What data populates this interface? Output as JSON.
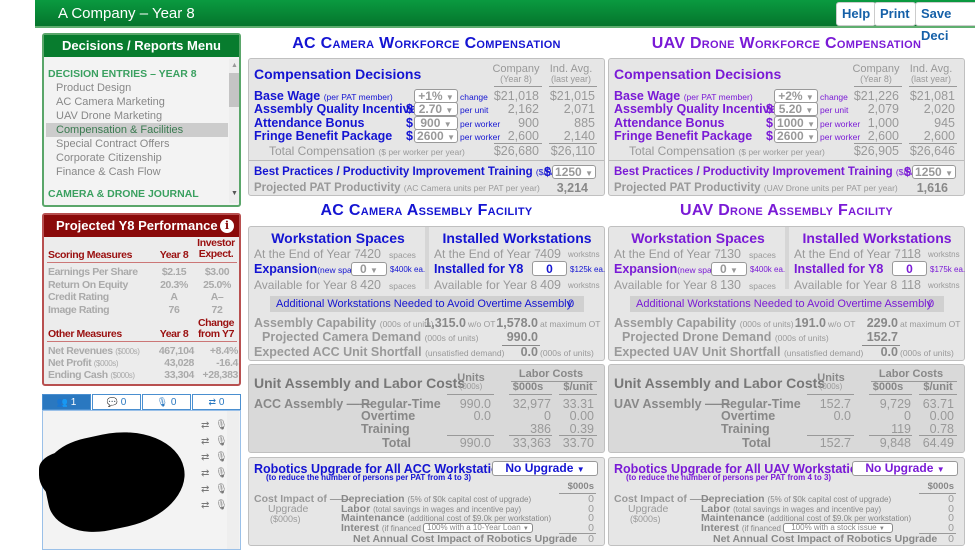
{
  "header": {
    "title": "A Company – Year 8",
    "buttons": [
      "Help",
      "Print",
      "Save Deci"
    ]
  },
  "menu": {
    "title": "Decisions / Reports Menu",
    "section": "DECISION ENTRIES – YEAR 8",
    "items": [
      "Product Design",
      "AC Camera Marketing",
      "UAV Drone Marketing",
      "Compensation & Facilities",
      "Special Contract Offers",
      "Corporate Citizenship",
      "Finance & Cash Flow"
    ],
    "selected": "Compensation & Facilities",
    "journal": "CAMERA & DRONE JOURNAL"
  },
  "performance": {
    "title": "Projected Y8 Performance",
    "info_icon": "info-circle-icon",
    "scoring_header": "Scoring Measures",
    "col_year": "Year 8",
    "col_investor": "Investor Expect.",
    "scoring": [
      {
        "label": "Earnings Per Share",
        "year8": "$2.15",
        "investor": "$3.00"
      },
      {
        "label": "Return On Equity",
        "year8": "20.3%",
        "investor": "25.0%"
      },
      {
        "label": "Credit Rating",
        "year8": "A",
        "investor": "A–"
      },
      {
        "label": "Image Rating",
        "year8": "76",
        "investor": "72"
      }
    ],
    "other_header": "Other Measures",
    "col_year2": "Year 8",
    "col_change": "Change from Y7",
    "other": [
      {
        "label": "Net Revenues",
        "sub": "($000s)",
        "year8": "467,104",
        "change": "+8.4%"
      },
      {
        "label": "Net Profit",
        "sub": "($000s)",
        "year8": "43,028",
        "change": "-16.4"
      },
      {
        "label": "Ending Cash",
        "sub": "($000s)",
        "year8": "33,304",
        "change": "+28,383"
      }
    ]
  },
  "chat": {
    "tabs": [
      {
        "icon": "users-icon",
        "count": "1"
      },
      {
        "icon": "comments-icon",
        "count": "0"
      },
      {
        "icon": "microphone-icon",
        "count": "0"
      },
      {
        "icon": "retweet-icon",
        "count": "0"
      }
    ]
  },
  "products": [
    {
      "accent": "#1414d2",
      "comp_title": "AC Camera Workforce Compensation",
      "comp": {
        "heading": "Compensation Decisions",
        "col_company": "Company",
        "col_company_sub": "(Year 8)",
        "col_ind": "Ind. Avg.",
        "col_ind_sub": "(last year)",
        "rows": [
          {
            "label": "Base Wage",
            "sub": "(per PAT member)",
            "prefix": "",
            "value": "+1%",
            "unit": "change",
            "company": "$21,018",
            "ind": "$21,015"
          },
          {
            "label": "Assembly Quality Incentive",
            "sub": "",
            "prefix": "$",
            "value": "2.70",
            "unit": "per unit",
            "company": "2,162",
            "ind": "2,071"
          },
          {
            "label": "Attendance Bonus",
            "sub": "",
            "prefix": "$",
            "value": "900",
            "unit": "per worker",
            "company": "900",
            "ind": "885"
          },
          {
            "label": "Fringe Benefit Package",
            "sub": "",
            "prefix": "$",
            "value": "2600",
            "unit": "per worker",
            "company": "2,600",
            "ind": "2,140"
          }
        ],
        "total": {
          "label": "Total Compensation",
          "sub": "($ per worker per year)",
          "company": "$26,680",
          "ind": "$26,110"
        },
        "training": {
          "label": "Best Practices / Productivity Improvement Training",
          "sub": "($/PAT)",
          "prefix": "$",
          "value": "1250"
        },
        "productivity": {
          "label": "Projected PAT Productivity",
          "sub": "(AC Camera units per PAT per year)",
          "value": "3,214"
        }
      },
      "facility_title": "AC Camera Assembly Facility",
      "facility": {
        "spaces_heading": "Workstation Spaces",
        "installed_heading": "Installed Workstations",
        "end_label": "At the End of Year 7",
        "spaces_end": "420",
        "spaces_unit": "spaces",
        "expansion_label": "Expansion",
        "expansion_sub": "(new spaces)",
        "expansion_value": "0",
        "expansion_unit": "$400k ea.",
        "avail_label": "Available for Year 8",
        "spaces_avail": "420",
        "ws_end": "409",
        "ws_unit": "workstns",
        "installed_label": "Installed for Y8",
        "installed_value": "0",
        "installed_unit": "$125k ea.",
        "ws_avail": "409",
        "additional_label": "Additional Workstations Needed to Avoid Overtime Assembly",
        "additional_value": "0",
        "capability_label": "Assembly Capability",
        "capability_sub": "(000s of units)",
        "cap_wo": "1,315.0",
        "cap_wo_unit": "w/o OT",
        "cap_max": "1,578.0",
        "cap_max_unit": "at maximum OT",
        "demand_label": "Projected Camera Demand",
        "demand_sub": "(000s of units)",
        "demand_value": "990.0",
        "shortfall_label": "Expected ACC Unit Shortfall",
        "shortfall_sub": "(unsatisfied demand)",
        "shortfall_value": "0.0",
        "shortfall_unit": "(000s of units)"
      },
      "labor": {
        "heading": "Unit Assembly and Labor Costs",
        "units_header": "Units",
        "units_sub": "(000s)",
        "labor_header": "Labor Costs",
        "col_cost": "$000s",
        "col_unit": "$/unit",
        "group_label": "ACC Assembly ——",
        "rows": [
          {
            "label": "Regular-Time",
            "units": "990.0",
            "cost": "32,977",
            "per_unit": "33.31"
          },
          {
            "label": "Overtime",
            "units": "0.0",
            "cost": "0",
            "per_unit": "0.00"
          },
          {
            "label": "Training",
            "units": "",
            "cost": "386",
            "per_unit": "0.39"
          },
          {
            "label": "Total",
            "units": "990.0",
            "cost": "33,363",
            "per_unit": "33.70"
          }
        ]
      },
      "robotics": {
        "heading": "Robotics Upgrade for All ACC Workstations",
        "sub": "(to reduce the number of persons per PAT from 4 to 3)",
        "select": "No Upgrade",
        "col": "$000s",
        "impact1": "Cost Impact of ——",
        "impact2": "Upgrade",
        "impact3": "($000s)",
        "rows": [
          {
            "label": "Depreciation",
            "sub": "(5% of $0k capital cost of upgrade)",
            "value": "0"
          },
          {
            "label": "Labor",
            "sub": "(total savings in wages and incentive pay)",
            "value": "0"
          },
          {
            "label": "Maintenance",
            "sub": "(additional cost of $9.0k per workstation)",
            "value": "0"
          },
          {
            "label": "Interest",
            "sub": "(if financed",
            "value": "0"
          }
        ],
        "financing": "100% with a 10-Year Loan",
        "net_label": "Net Annual Cost Impact of Robotics Upgrade",
        "net_value": "0"
      }
    },
    {
      "accent": "#7a1ad6",
      "comp_title": "UAV Drone Workforce Compensation",
      "comp": {
        "heading": "Compensation Decisions",
        "col_company": "Company",
        "col_company_sub": "(Year 8)",
        "col_ind": "Ind. Avg.",
        "col_ind_sub": "(last year)",
        "rows": [
          {
            "label": "Base Wage",
            "sub": "(per PAT member)",
            "prefix": "",
            "value": "+2%",
            "unit": "change",
            "company": "$21,226",
            "ind": "$21,081"
          },
          {
            "label": "Assembly Quality Incentive",
            "sub": "",
            "prefix": "$",
            "value": "5.20",
            "unit": "per unit",
            "company": "2,079",
            "ind": "2,020"
          },
          {
            "label": "Attendance Bonus",
            "sub": "",
            "prefix": "$",
            "value": "1000",
            "unit": "per worker",
            "company": "1,000",
            "ind": "945"
          },
          {
            "label": "Fringe Benefit Package",
            "sub": "",
            "prefix": "$",
            "value": "2600",
            "unit": "per worker",
            "company": "2,600",
            "ind": "2,600"
          }
        ],
        "total": {
          "label": "Total Compensation",
          "sub": "($ per worker per year)",
          "company": "$26,905",
          "ind": "$26,646"
        },
        "training": {
          "label": "Best Practices / Productivity Improvement Training",
          "sub": "($/PAT)",
          "prefix": "$",
          "value": "1250"
        },
        "productivity": {
          "label": "Projected PAT Productivity",
          "sub": "(UAV Drone units per PAT per year)",
          "value": "1,616"
        }
      },
      "facility_title": "UAV Drone Assembly Facility",
      "facility": {
        "spaces_heading": "Workstation Spaces",
        "installed_heading": "Installed Workstations",
        "end_label": "At the End of Year 7",
        "spaces_end": "130",
        "spaces_unit": "spaces",
        "expansion_label": "Expansion",
        "expansion_sub": "(new spaces)",
        "expansion_value": "0",
        "expansion_unit": "$400k ea.",
        "avail_label": "Available for Year 8",
        "spaces_avail": "130",
        "ws_end": "118",
        "ws_unit": "workstns",
        "installed_label": "Installed for Y8",
        "installed_value": "0",
        "installed_unit": "$175k ea.",
        "ws_avail": "118",
        "additional_label": "Additional Workstations Needed to Avoid Overtime Assembly",
        "additional_value": "0",
        "capability_label": "Assembly Capability",
        "capability_sub": "(000s of units)",
        "cap_wo": "191.0",
        "cap_wo_unit": "w/o OT",
        "cap_max": "229.0",
        "cap_max_unit": "at maximum OT",
        "demand_label": "Projected Drone Demand",
        "demand_sub": "(000s of units)",
        "demand_value": "152.7",
        "shortfall_label": "Expected UAV Unit Shortfall",
        "shortfall_sub": "(unsatisfied demand)",
        "shortfall_value": "0.0",
        "shortfall_unit": "(000s of units)"
      },
      "labor": {
        "heading": "Unit Assembly and Labor Costs",
        "units_header": "Units",
        "units_sub": "(000s)",
        "labor_header": "Labor Costs",
        "col_cost": "$000s",
        "col_unit": "$/unit",
        "group_label": "UAV Assembly ——",
        "rows": [
          {
            "label": "Regular-Time",
            "units": "152.7",
            "cost": "9,729",
            "per_unit": "63.71"
          },
          {
            "label": "Overtime",
            "units": "0.0",
            "cost": "0",
            "per_unit": "0.00"
          },
          {
            "label": "Training",
            "units": "",
            "cost": "119",
            "per_unit": "0.78"
          },
          {
            "label": "Total",
            "units": "152.7",
            "cost": "9,848",
            "per_unit": "64.49"
          }
        ]
      },
      "robotics": {
        "heading": "Robotics Upgrade for All UAV Workstations",
        "sub": "(to reduce the number of persons per PAT from 4 to 3)",
        "select": "No Upgrade",
        "col": "$000s",
        "impact1": "Cost Impact of ——",
        "impact2": "Upgrade",
        "impact3": "($000s)",
        "rows": [
          {
            "label": "Depreciation",
            "sub": "(5% of $0k capital cost of upgrade)",
            "value": "0"
          },
          {
            "label": "Labor",
            "sub": "(total savings in wages and incentive pay)",
            "value": "0"
          },
          {
            "label": "Maintenance",
            "sub": "(additional cost of $9.0k per workstation)",
            "value": "0"
          },
          {
            "label": "Interest",
            "sub": "(if financed",
            "value": "0"
          }
        ],
        "financing": "100% with a stock issue",
        "net_label": "Net Annual Cost Impact of Robotics Upgrade",
        "net_value": "0"
      }
    }
  ]
}
